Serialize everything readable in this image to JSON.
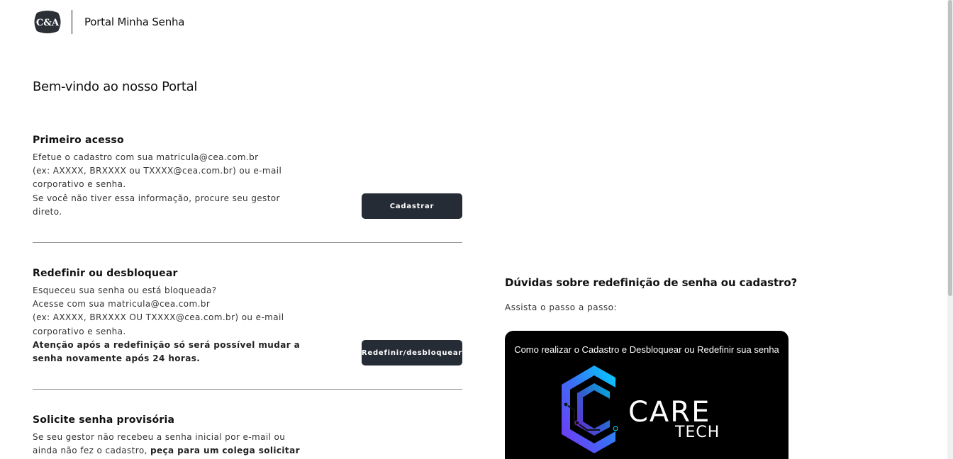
{
  "header": {
    "logo_text": "C&A",
    "title": "Portal Minha Senha"
  },
  "welcome": "Bem-vindo ao nosso Portal",
  "sections": [
    {
      "title": "Primeiro acesso",
      "lines": [
        "Efetue o cadastro com sua matricula@cea.com.br",
        "(ex: AXXXX, BRXXXX ou TXXXX@cea.com.br) ou e-mail",
        "corporativo e senha.",
        "Se você não tiver essa informação, procure seu gestor",
        "direto."
      ],
      "button": "Cadastrar"
    },
    {
      "title": "Redefinir ou desbloquear",
      "lines": [
        "Esqueceu sua senha ou está bloqueada?",
        "Acesse com sua matricula@cea.com.br",
        "(ex: AXXXX, BRXXXX OU TXXXX@cea.com.br) ou e-mail",
        "corporativo e senha."
      ],
      "strong_lines": [
        "Atenção após a redefinição só será possível mudar a",
        "senha novamente após 24 horas."
      ],
      "button": "Redefinir/desbloquear"
    },
    {
      "title": "Solicite senha provisória",
      "line1": "Se seu gestor não recebeu a senha inicial por e-mail ou",
      "line2_normal": "ainda não fez o cadastro, ",
      "line2_strong": "peça para um colega solicitar"
    }
  ],
  "faq": {
    "title": "Dúvidas sobre redefinição de senha ou cadastro?",
    "subtitle": "Assista o passo a passo:",
    "video_title": "Como realizar o Cadastro e Desbloquear ou Redefinir sua senha",
    "video_logo_word1": "CARE",
    "video_logo_word2": "TECH"
  },
  "colors": {
    "button_bg": "#262c36",
    "logo_bg": "#2b2f36",
    "video_gradient_start": "#7b2ff7",
    "video_gradient_end": "#00d4ff"
  },
  "icons": {
    "logo": "cea-logo-icon",
    "video_logo": "caretech-logo-icon"
  }
}
